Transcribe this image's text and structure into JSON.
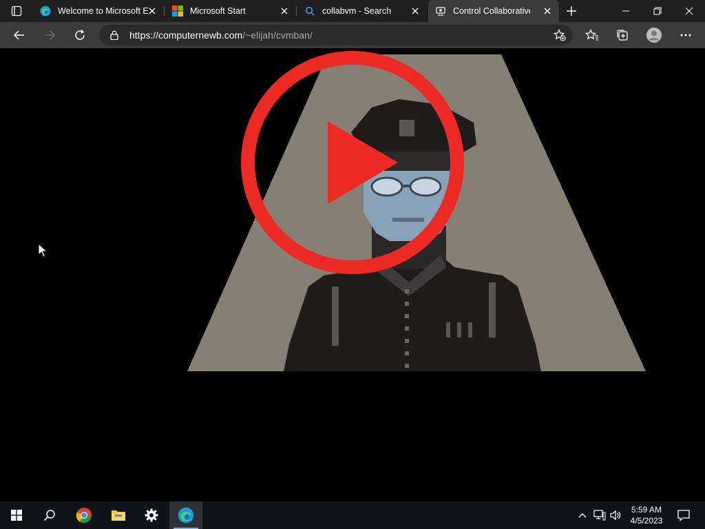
{
  "browser": {
    "tabs": [
      {
        "title": "Welcome to Microsoft E",
        "icon": "edge-icon",
        "active": false
      },
      {
        "title": "Microsoft Start",
        "icon": "microsoft-logo-icon",
        "active": false
      },
      {
        "title": "collabvm - Search",
        "icon": "search-icon",
        "active": false
      },
      {
        "title": "Control Collaborative V",
        "icon": "collabvm-icon",
        "active": true
      }
    ],
    "address": {
      "host": "https://computernewb.com",
      "path": "/~elijah/cvmban/"
    }
  },
  "taskbar": {
    "pinned": [
      "start-icon",
      "search-icon",
      "chrome-icon",
      "file-explorer-icon",
      "settings-icon",
      "edge-icon"
    ],
    "clock": {
      "time": "5:59 AM",
      "date": "4/5/2023"
    }
  },
  "colors": {
    "tabbar": "#202020",
    "toolbar": "#3b3b3b",
    "play_red": "#ee2a24",
    "spotlight": "#868074"
  }
}
